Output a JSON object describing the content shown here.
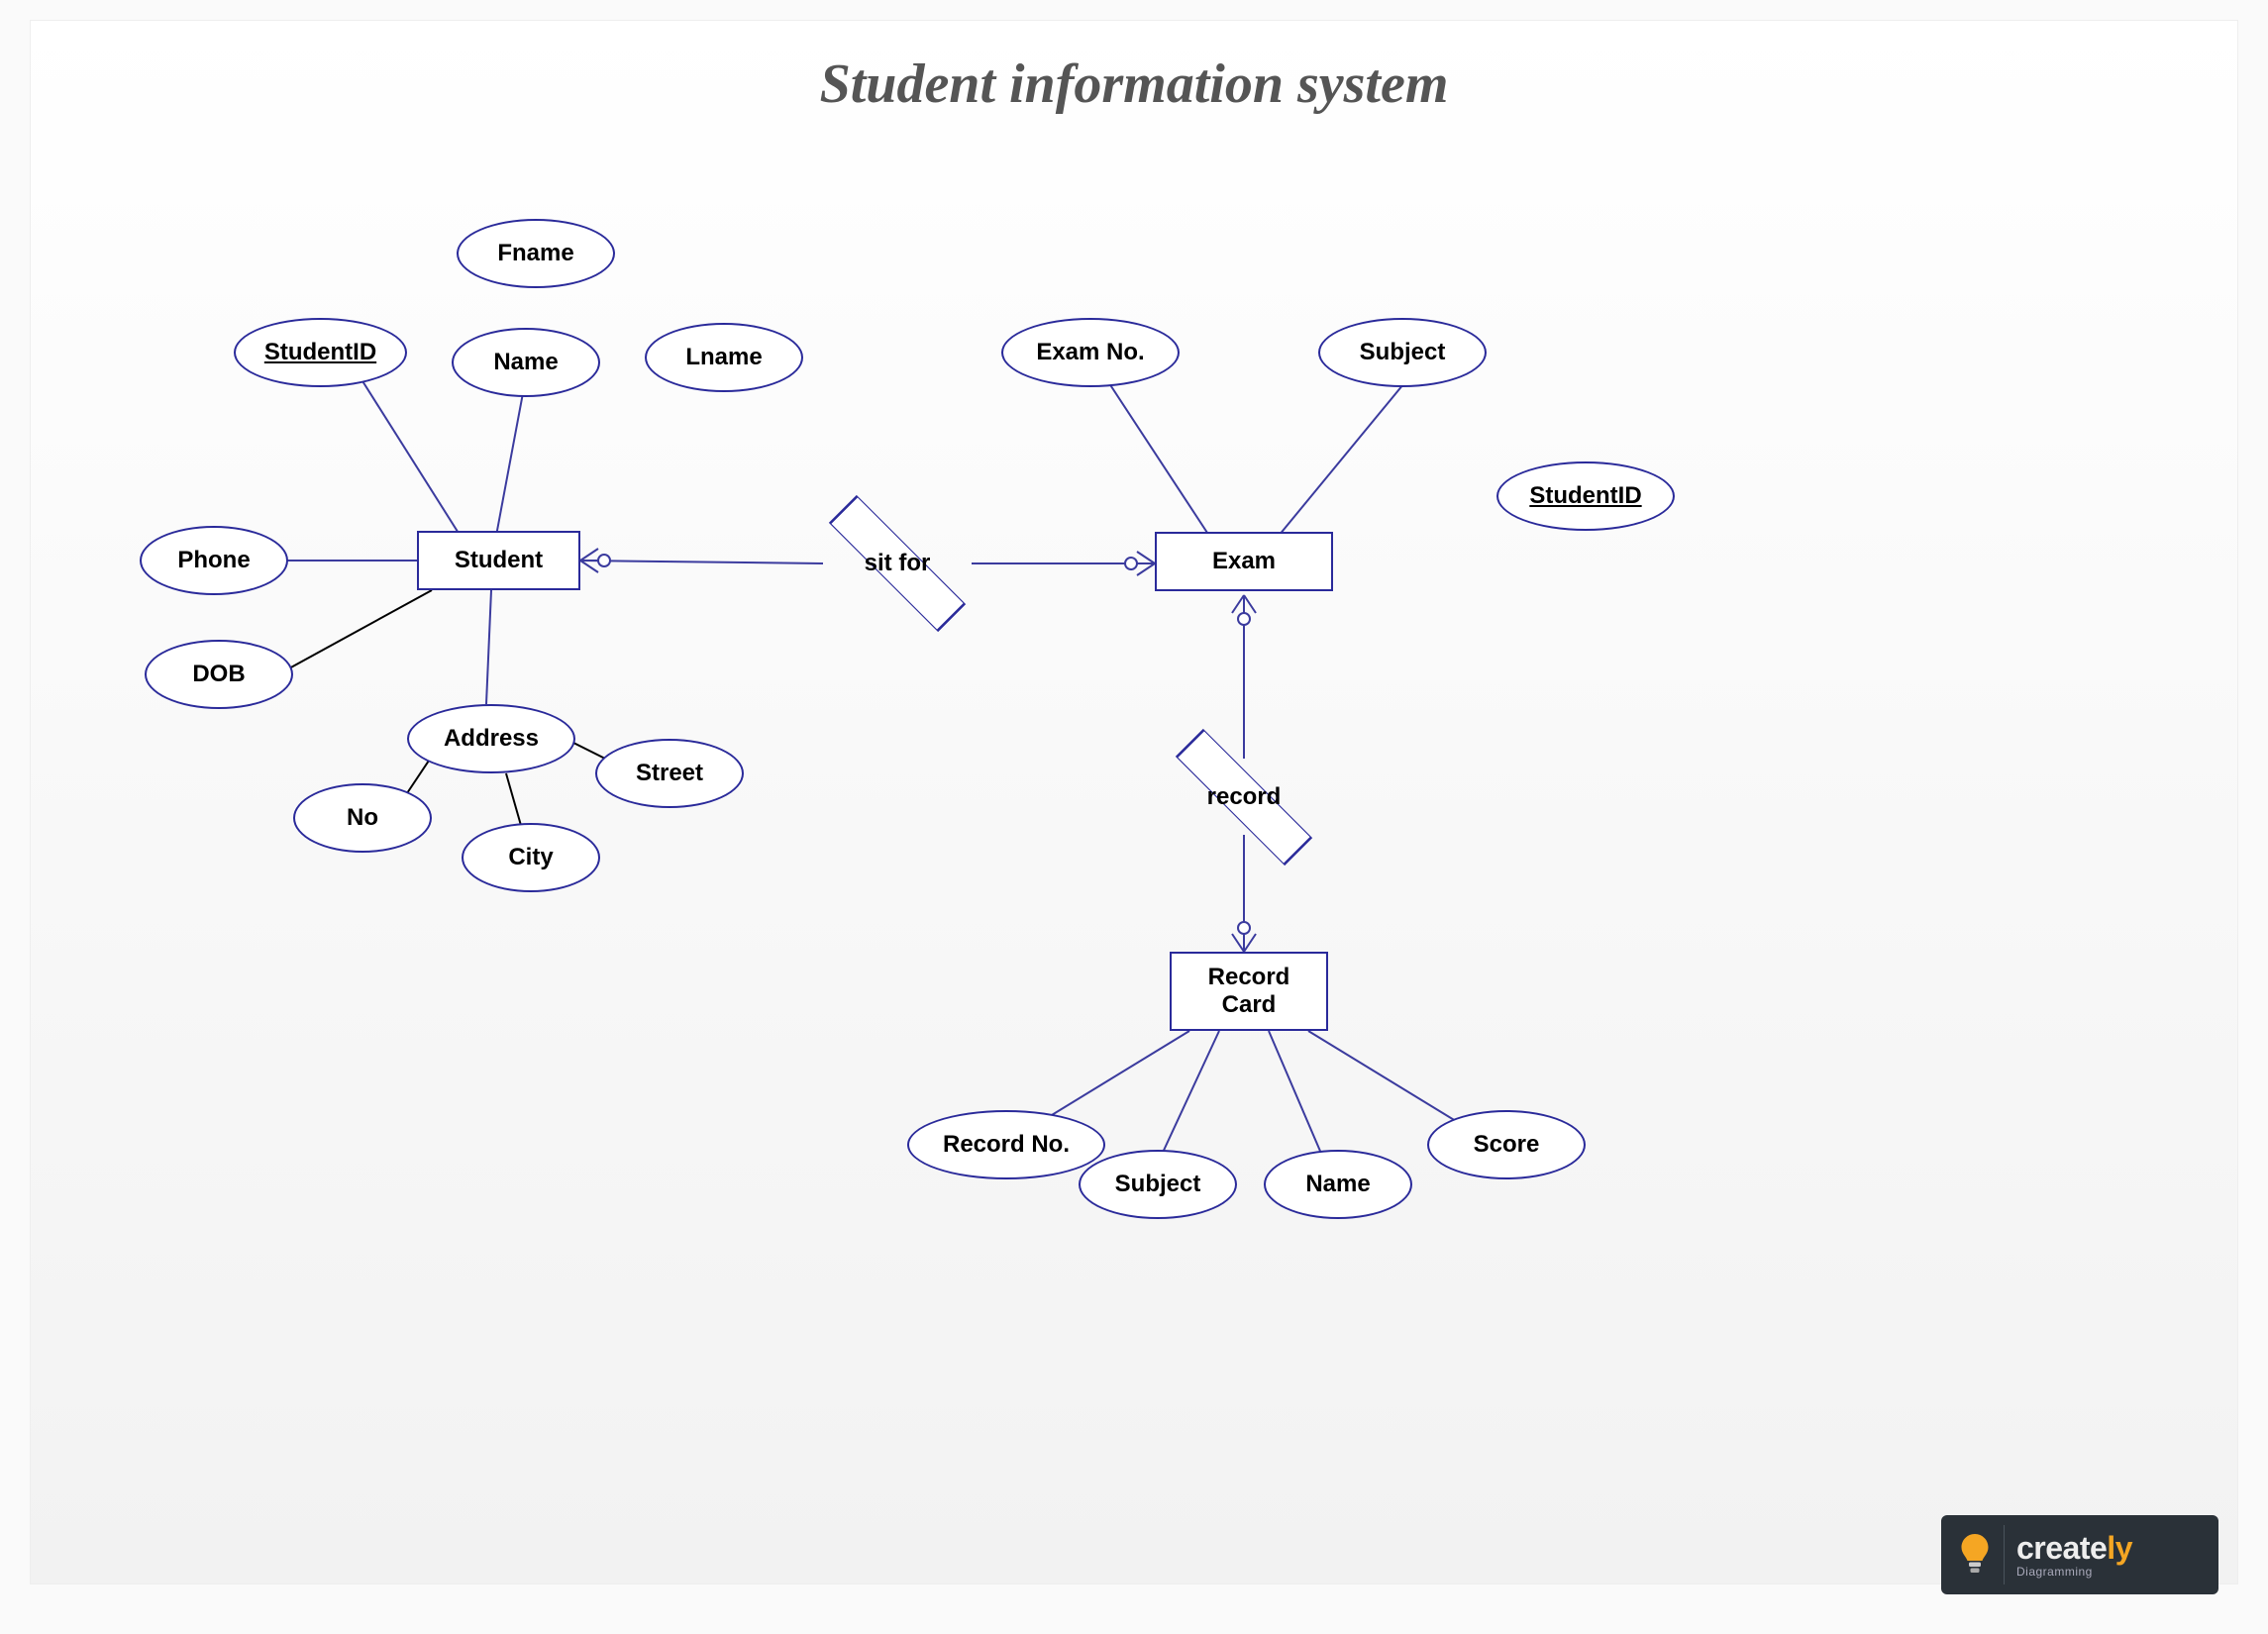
{
  "title": "Student information system",
  "entities": {
    "student": "Student",
    "exam": "Exam",
    "recordcard": "Record\nCard"
  },
  "relationships": {
    "sitfor": "sit for",
    "record": "record"
  },
  "attributes": {
    "student": {
      "studentid": "StudentID",
      "name": "Name",
      "fname": "Fname",
      "lname": "Lname",
      "phone": "Phone",
      "dob": "DOB",
      "address": "Address",
      "no": "No",
      "city": "City",
      "street": "Street"
    },
    "exam": {
      "examno": "Exam No.",
      "subject": "Subject",
      "studentid": "StudentID"
    },
    "recordcard": {
      "recordno": "Record No.",
      "subject": "Subject",
      "name": "Name",
      "score": "Score"
    }
  },
  "connections": [
    {
      "from": "student",
      "to": "sitfor",
      "type": "one-or-many"
    },
    {
      "from": "sitfor",
      "to": "exam",
      "type": "one-or-many"
    },
    {
      "from": "exam",
      "to": "record",
      "type": "one-or-many"
    },
    {
      "from": "record",
      "to": "recordcard",
      "type": "one-or-many"
    }
  ],
  "logo": {
    "brand_main": "create",
    "brand_accent": "ly",
    "tagline": "Diagramming"
  }
}
